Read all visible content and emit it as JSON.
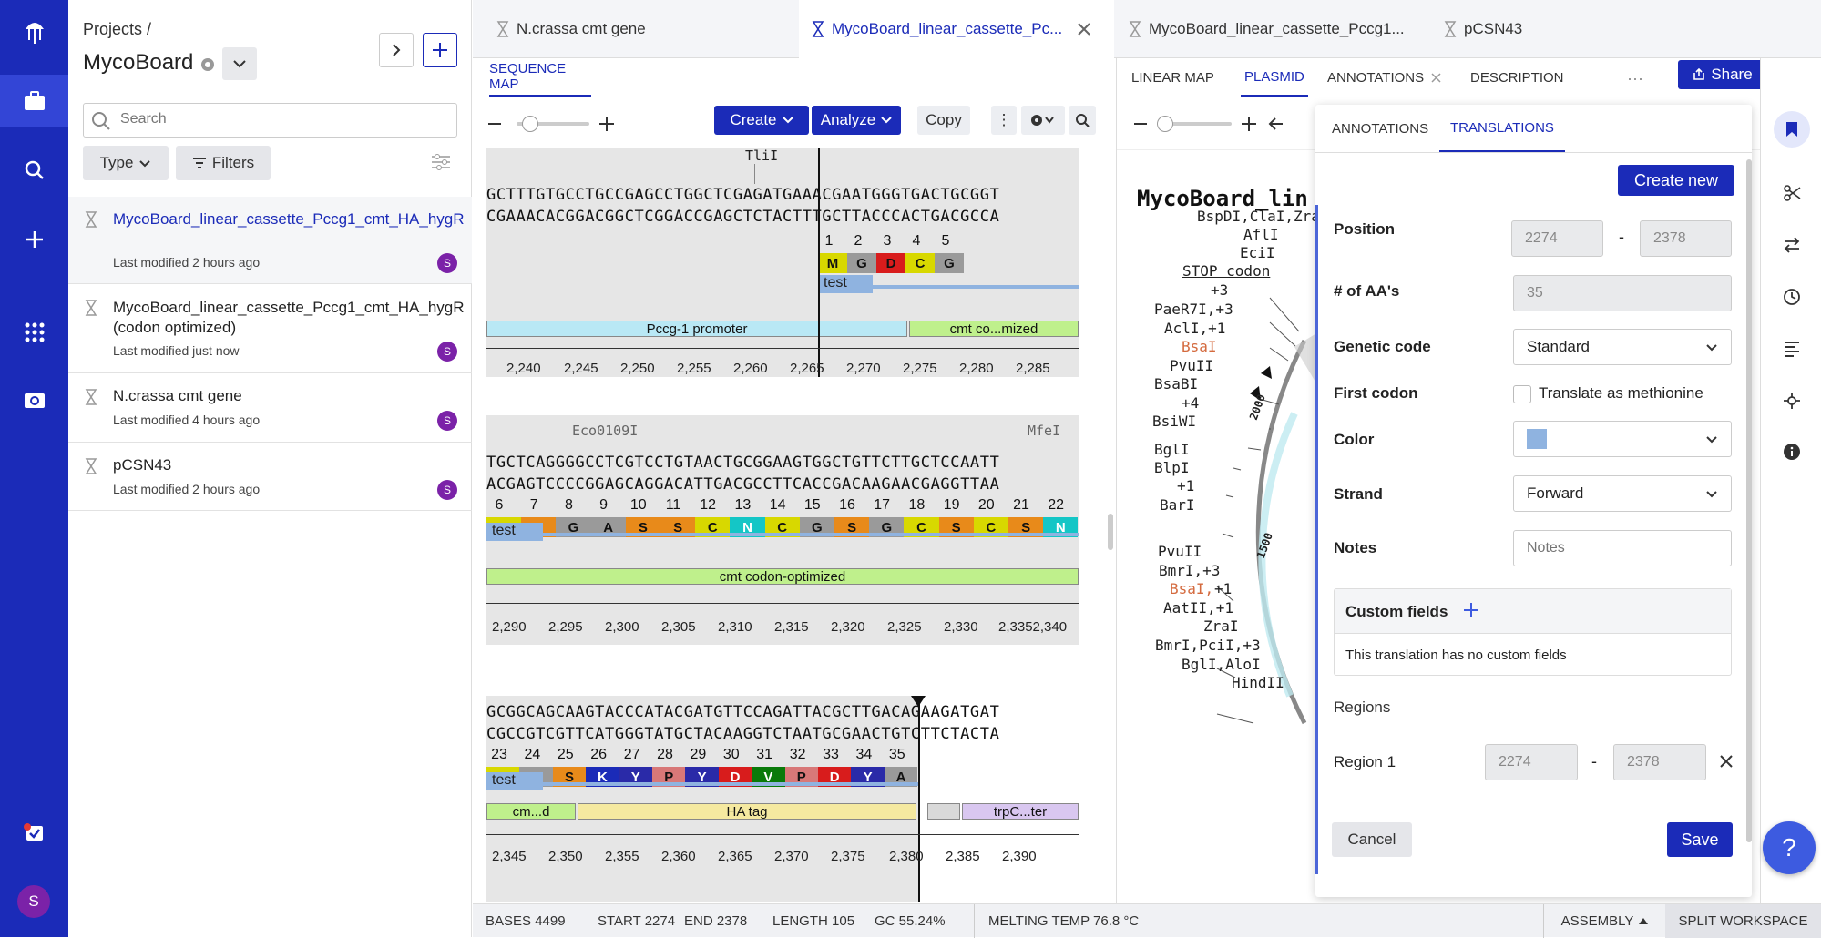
{
  "sidebar": {
    "user_initial": "S"
  },
  "projects": {
    "breadcrumb": "Projects /",
    "name": "MycoBoard",
    "search_placeholder": "Search",
    "type_label": "Type",
    "filters_label": "Filters",
    "files": [
      {
        "name": "MycoBoard_linear_cassette_Pccg1_cmt_HA_hygR",
        "modified": "Last modified 2 hours ago",
        "initial": "S",
        "active": true
      },
      {
        "name": "MycoBoard_linear_cassette_Pccg1_cmt_HA_hygR (codon optimized)",
        "modified": "Last modified just now",
        "initial": "S"
      },
      {
        "name": "N.crassa cmt gene",
        "modified": "Last modified 4 hours ago",
        "initial": "S"
      },
      {
        "name": "pCSN43",
        "modified": "Last modified 2 hours ago",
        "initial": "S"
      }
    ]
  },
  "tabs": [
    "N.crassa cmt gene",
    "MycoBoard_linear_cassette_Pc...",
    "MycoBoard_linear_cassette_Pccg1...",
    "pCSN43"
  ],
  "left_panel": {
    "subtab": "SEQUENCE MAP",
    "create": "Create",
    "analyze": "Analyze",
    "copy": "Copy",
    "blocks": [
      {
        "enzyme_labels": [
          "TliI"
        ],
        "top": "GCTTTGTGCCTGCCGAGCCTGGCTCGAGATGAAACGAATGGGTGACTGCGGT",
        "bottom": "CGAAACACGGACGGCTCGGACCGAGCTCTACTTTGCTTACCCACTGACGCCA",
        "aa_numbers": [
          "1",
          "2",
          "3",
          "4",
          "5"
        ],
        "aa_letters": [
          "M",
          "G",
          "D",
          "C",
          "G"
        ],
        "test_label": "test",
        "features": [
          "Pccg-1 promoter",
          "cmt co...mized"
        ],
        "axis": [
          "2,240",
          "2,245",
          "2,250",
          "2,255",
          "2,260",
          "2,265",
          "2,270",
          "2,275",
          "2,280",
          "2,285"
        ]
      },
      {
        "enzyme_labels": [
          "Eco0109I",
          "MfeI"
        ],
        "top": "TGCTCAGGGGCCTCGTCCTGTAACTGCGGAAGTGGCTGTTCTTGCTCCAATT",
        "bottom": "ACGAGTCCCCGGAGCAGGACATTGACGCCTTCACCGACAAGAACGAGGTTAA",
        "aa_numbers": [
          "6",
          "7",
          "8",
          "9",
          "10",
          "11",
          "12",
          "13",
          "14",
          "15",
          "16",
          "17",
          "18",
          "19",
          "20",
          "21",
          "22"
        ],
        "aa_letters": [
          "C",
          "S",
          "G",
          "A",
          "S",
          "S",
          "C",
          "N",
          "C",
          "G",
          "S",
          "G",
          "C",
          "S",
          "C",
          "S",
          "N"
        ],
        "test_label": "test",
        "features": [
          "cmt codon-optimized"
        ],
        "axis": [
          "2,290",
          "2,295",
          "2,300",
          "2,305",
          "2,310",
          "2,315",
          "2,320",
          "2,325",
          "2,330",
          "2,3352,340"
        ]
      },
      {
        "top": "GCGGCAGCAAGTACCCATACGATGTTCCAGATTACGCTTGACAGAAGATGAT",
        "bottom": "CGCCGTCGTTCATGGGTATGCTACAAGGTCTAATGCGAACTGTCTTCTACTA",
        "aa_numbers": [
          "23",
          "24",
          "25",
          "26",
          "27",
          "28",
          "29",
          "30",
          "31",
          "32",
          "33",
          "34",
          "35"
        ],
        "aa_letters": [
          "C",
          "G",
          "S",
          "K",
          "Y",
          "P",
          "Y",
          "D",
          "V",
          "P",
          "D",
          "Y",
          "A"
        ],
        "test_label": "test",
        "features": [
          "cm...d",
          "HA tag",
          "trpC...ter"
        ],
        "axis": [
          "2,345",
          "2,350",
          "2,355",
          "2,360",
          "2,365",
          "2,370",
          "2,375",
          "2,380",
          "2,385",
          "2,390"
        ]
      }
    ]
  },
  "mid_panel": {
    "subtabs": [
      "LINEAR MAP",
      "PLASMID",
      "ANNOTATIONS",
      "DESCRIPTION"
    ],
    "share": "Share",
    "title": "MycoBoard_lin",
    "labels": [
      "BspDI,ClaI,Zra",
      "AflI",
      "EciI",
      "STOP codon",
      "+3",
      "PaeR7I,+3",
      "AclI,+1",
      "BsaI",
      "PvuII",
      "BsaBI",
      "+4",
      "BsiWI",
      "BglI",
      "BlpI",
      "+1",
      "BarI",
      "PvuII",
      "BmrI,+3",
      "BsaI,",
      "+1",
      "AatII,+1",
      "ZraI",
      "BmrI,PciI,+3",
      "BglI,AloI",
      "HindII"
    ],
    "ticks": [
      "2000",
      "1500"
    ]
  },
  "translation": {
    "tabs": [
      "ANNOTATIONS",
      "TRANSLATIONS"
    ],
    "create_new": "Create new",
    "position_label": "Position",
    "position_start": "2274",
    "position_end": "2378",
    "dash": "-",
    "aa_label": "# of AA's",
    "aa_value": "35",
    "genetic_code_label": "Genetic code",
    "genetic_code_value": "Standard",
    "first_codon_label": "First codon",
    "first_codon_option": "Translate as methionine",
    "color_label": "Color",
    "color_value": "#8fb3e0",
    "strand_label": "Strand",
    "strand_value": "Forward",
    "notes_label": "Notes",
    "notes_placeholder": "Notes",
    "custom_fields_label": "Custom fields",
    "custom_fields_empty": "This translation has no custom fields",
    "regions_label": "Regions",
    "region1_label": "Region 1",
    "region1_start": "2274",
    "region1_end": "2378",
    "cancel": "Cancel",
    "save": "Save"
  },
  "status": {
    "bases_label": "BASES",
    "bases": "4499",
    "start_label": "START",
    "start": "2274",
    "end_label": "END",
    "end": "2378",
    "length_label": "LENGTH",
    "length": "105",
    "gc_label": "GC",
    "gc": "55.24%",
    "tm_label": "MELTING TEMP",
    "tm": "76.8 °C",
    "assembly": "ASSEMBLY",
    "split": "SPLIT WORKSPACE"
  },
  "colors": {
    "brand": "#1b2bb8",
    "promoter": "#b9e8f5",
    "cds": "#bff08c",
    "hatag": "#f5e9a0",
    "terminator": "#d9c7f0"
  }
}
